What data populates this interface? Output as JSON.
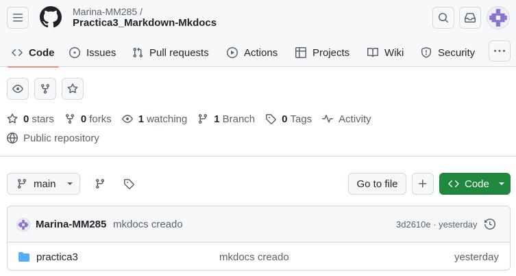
{
  "header": {
    "owner": "Marina-MM285 /",
    "repo": "Practica3_Markdown-Mkdocs"
  },
  "nav": {
    "tabs": [
      {
        "label": "Code",
        "icon": "code-icon",
        "active": true
      },
      {
        "label": "Issues",
        "icon": "issue-icon"
      },
      {
        "label": "Pull requests",
        "icon": "pull-request-icon"
      },
      {
        "label": "Actions",
        "icon": "play-icon"
      },
      {
        "label": "Projects",
        "icon": "table-icon"
      },
      {
        "label": "Wiki",
        "icon": "book-icon"
      },
      {
        "label": "Security",
        "icon": "shield-icon"
      }
    ]
  },
  "stats": {
    "stars_count": "0",
    "stars_label": "stars",
    "forks_count": "0",
    "forks_label": "forks",
    "watching_count": "1",
    "watching_label": "watching",
    "branch_count": "1",
    "branch_label": "Branch",
    "tags_count": "0",
    "tags_label": "Tags",
    "activity_label": "Activity",
    "visibility": "Public repository"
  },
  "toolbar": {
    "branch": "main",
    "go_to_file": "Go to file",
    "code_label": "Code",
    "code_button_color": "#1f883d"
  },
  "commit": {
    "author": "Marina-MM285",
    "message": "mkdocs creado",
    "meta": "3d2610e · yesterday"
  },
  "files": [
    {
      "name": "practica3",
      "message": "mkdocs creado",
      "date": "yesterday",
      "type": "folder"
    }
  ],
  "colors": {
    "accent_underline": "#fd8c73",
    "folder": "#54aeff"
  }
}
